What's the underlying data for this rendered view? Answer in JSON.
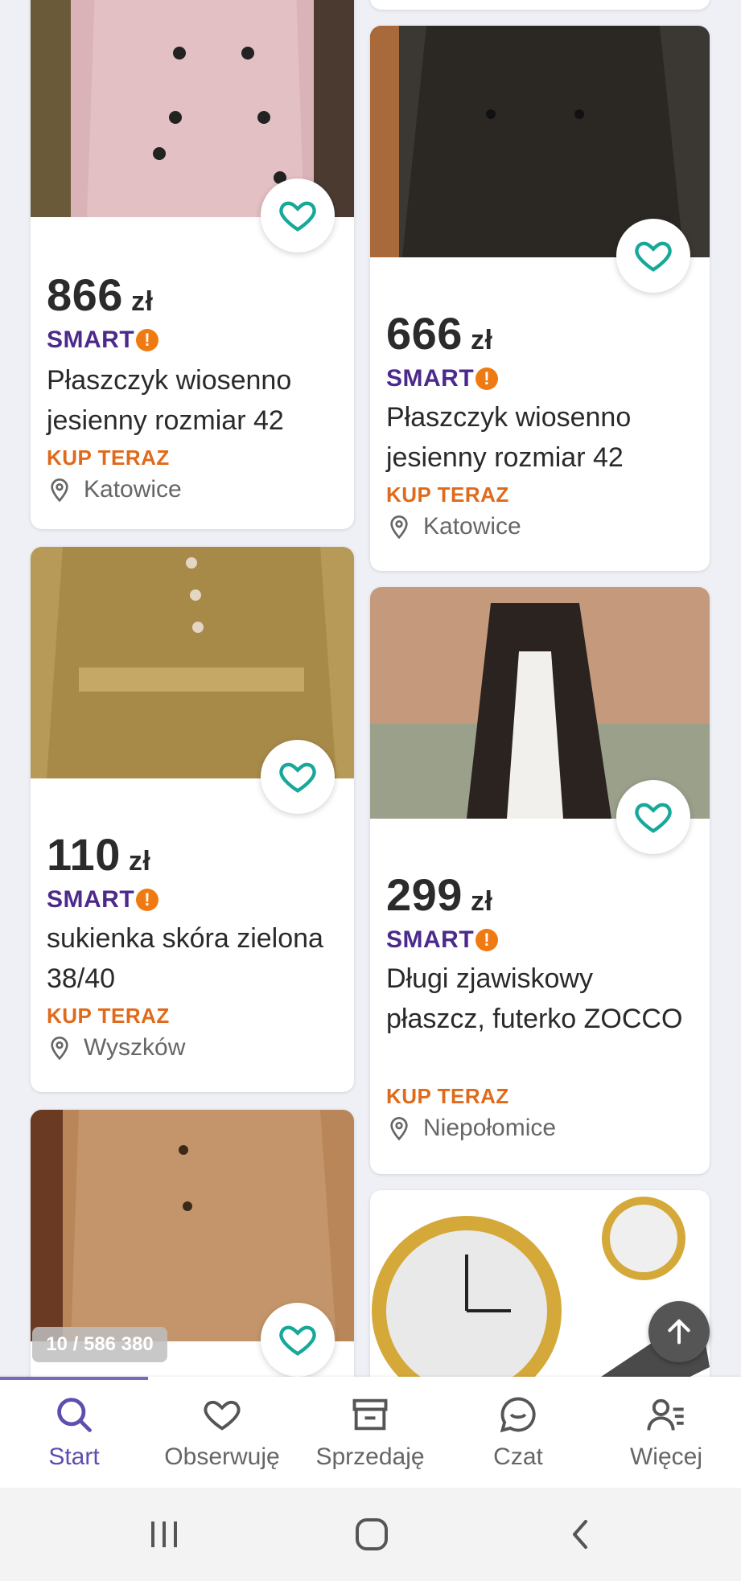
{
  "listings": [
    {
      "price": "866",
      "currency": "zł",
      "badge": "SMART",
      "title": "Płaszczyk wiosenno jesienny rozmiar 42",
      "cta": "KUP TERAZ",
      "location": "Katowice",
      "image_alt": "pink trench coat"
    },
    {
      "price": "666",
      "currency": "zł",
      "badge": "SMART",
      "title": "Płaszczyk wiosenno jesienny rozmiar 42",
      "cta": "KUP TERAZ",
      "location": "Katowice",
      "image_alt": "dark trench coat"
    },
    {
      "price": "110",
      "currency": "zł",
      "badge": "SMART",
      "title": "sukienka skóra zielona 38/40",
      "cta": "KUP TERAZ",
      "location": "Wyszków",
      "image_alt": "olive leather dress"
    },
    {
      "price": "299",
      "currency": "zł",
      "badge": "SMART",
      "title": "Długi zjawiskowy płaszcz, futerko ZOCCO",
      "cta": "KUP TERAZ",
      "location": "Niepołomice",
      "image_alt": "long coat with fur"
    },
    {
      "image_alt": "beige leather coat"
    },
    {
      "image_alt": "gold wrist watch"
    }
  ],
  "counter": "10 / 586 380",
  "nav": {
    "items": [
      {
        "label": "Start",
        "icon": "search-icon"
      },
      {
        "label": "Obserwuję",
        "icon": "heart-icon"
      },
      {
        "label": "Sprzedaję",
        "icon": "store-icon"
      },
      {
        "label": "Czat",
        "icon": "chat-icon"
      },
      {
        "label": "Więcej",
        "icon": "user-menu-icon"
      }
    ],
    "active_index": 0
  },
  "colors": {
    "accent": "#5d4fb0",
    "heart": "#17a89a",
    "cta": "#e06a1a",
    "smart": "#4b2a8c"
  }
}
